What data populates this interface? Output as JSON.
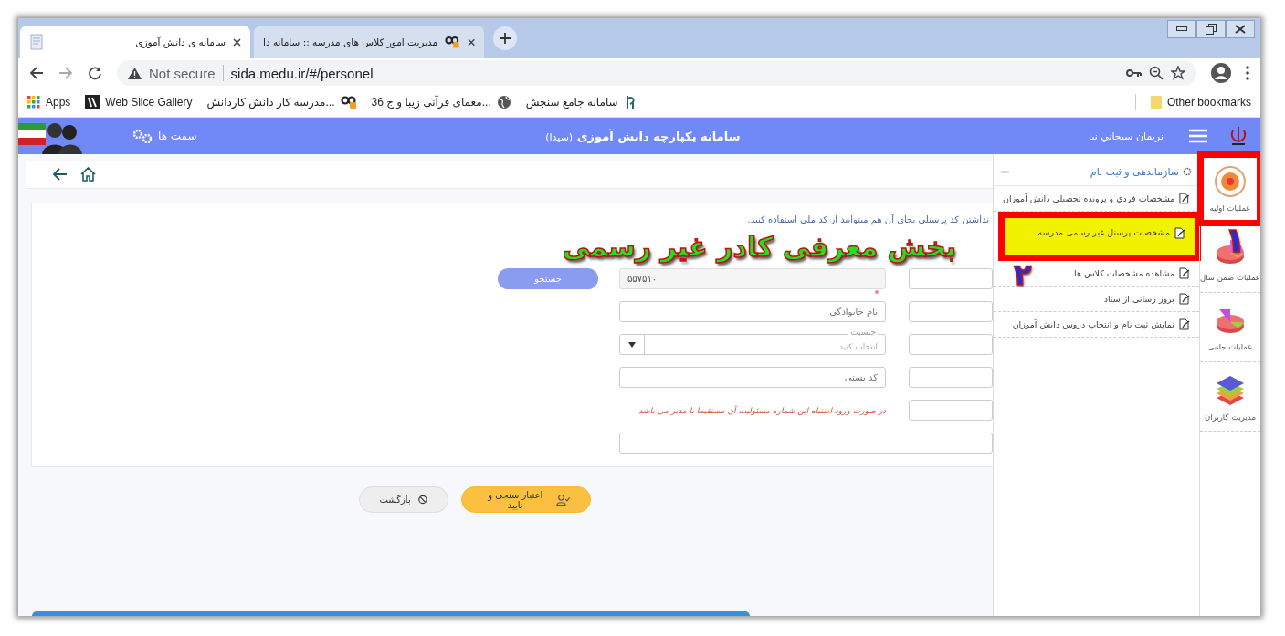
{
  "browser": {
    "tabs": [
      {
        "title": "مدیریت امور کلاس های مدرسه :: سامانه دا",
        "selected": false,
        "kind": "qp"
      },
      {
        "title": "سامانه ی دانش آموزی",
        "selected": true,
        "kind": "doc"
      }
    ],
    "address": {
      "security": "Not secure",
      "url": "sida.medu.ir/#/personel"
    },
    "bookmarks": [
      {
        "label": "سامانه جامع سنجش",
        "kind": "sanjesh"
      },
      {
        "label": "36 معمای قرآنی زیبا و ج...",
        "kind": "globe"
      },
      {
        "label": "مدرسه کار دانش کاردانش...",
        "kind": "qp"
      },
      {
        "label": "Web Slice Gallery",
        "kind": "slice"
      },
      {
        "label": "Apps",
        "kind": "apps"
      }
    ],
    "other_bookmarks": "Other bookmarks"
  },
  "header": {
    "roles": "سمت ها",
    "title": "سامانه یکپارچه دانش آموزی",
    "subtitle": "(سیدا)",
    "user": "نریمان سبحاني نيا"
  },
  "form": {
    "hint": "نداشتن کد پرسنلی بجای آن هم میتوانید از کد ملی استفاده کنید.",
    "search_button": "جستجو",
    "id_value": "۵۵۷۵۱۰",
    "fields": [
      {
        "kind": "input",
        "placeholder": "نام خانوادگی",
        "required": true
      },
      {
        "kind": "select",
        "label": "جنسیت",
        "placeholder": "انتخاب کنید...",
        "required": false
      },
      {
        "kind": "input",
        "placeholder": "کد پستی",
        "required": false
      },
      {
        "kind": "warning",
        "text": "در صورت ورود اشتباه این شماره مسئولیت آن مستقیما با مدیر می باشد"
      }
    ]
  },
  "buttons": [
    {
      "label": "اعتبار سنجی و تایید",
      "kind": "primary"
    },
    {
      "label": "بازگشت",
      "kind": "secondary"
    }
  ],
  "menu": {
    "title": "سازماندهی و ثبت نام",
    "expanded": true,
    "items": [
      {
        "label": "مشخصات فردي و پرونده تحصيلي دانش آموزان",
        "boxed": false
      },
      {
        "label": "مشخصات پرسنل غیر رسمی مدرسه",
        "boxed": true
      },
      {
        "label": "مشاهده مشخصات کلاس ها",
        "boxed": false
      },
      {
        "label": "بروز رسانی از ستاد",
        "boxed": false
      },
      {
        "label": "نمایش ثبت نام و انتخاب دروس دانش آموزان",
        "boxed": false
      }
    ]
  },
  "modules": [
    {
      "label": "عمليات اوليه",
      "kind": "gear",
      "boxed": true
    },
    {
      "label": "عملیات ضمن سال",
      "kind": "pie",
      "boxed": false
    },
    {
      "label": "عملیات جانبی",
      "kind": "pie2",
      "boxed": false
    },
    {
      "label": "مدیریت کاربران",
      "kind": "layers",
      "boxed": false
    }
  ],
  "annotations": {
    "caption": "بخش معرفی کادر غیر رسمی",
    "markers": [
      "۱",
      "۲"
    ]
  }
}
